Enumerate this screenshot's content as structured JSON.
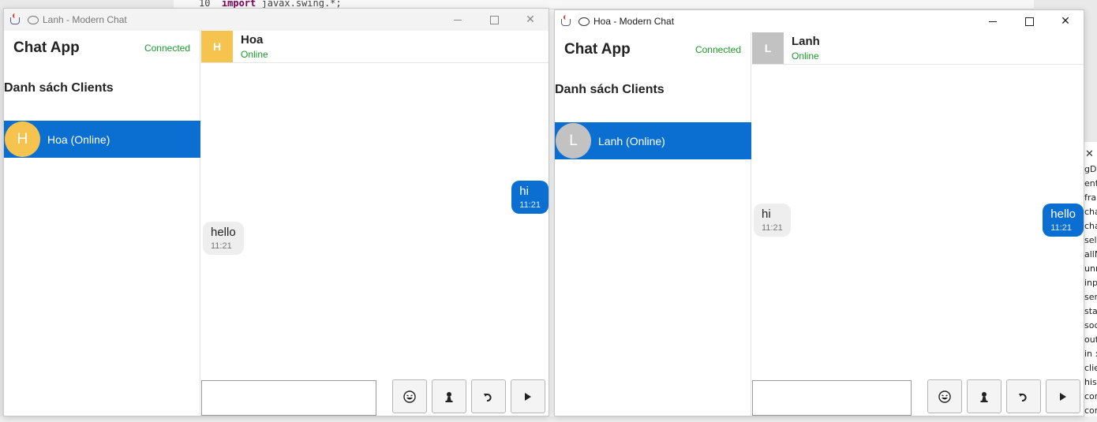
{
  "ide": {
    "line_no": "10",
    "keyword": "import",
    "code": " javax.swing.*;",
    "right_fragments": [
      "gDı",
      "ent",
      "frar",
      "cha",
      "cha",
      "sele",
      "allN",
      "unr",
      "inp",
      "ser",
      "stat",
      "soc",
      "out",
      "in :",
      "clie",
      "hist",
      "cor",
      "cor"
    ]
  },
  "windows": [
    {
      "title": "Lanh - Modern Chat",
      "app_title": "Chat App",
      "connection_status": "Connected",
      "clients_heading": "Danh sách Clients",
      "client": {
        "initial": "H",
        "label": "Hoa (Online)",
        "avatar_color": "#f7c34f"
      },
      "header": {
        "initial": "H",
        "name": "Hoa",
        "status": "Online",
        "avatar_color": "#f7c34f"
      },
      "messages": [
        {
          "text": "hi",
          "time": "11:21",
          "side": "sent"
        },
        {
          "text": "hello",
          "time": "11:21",
          "side": "received"
        }
      ],
      "input_value": ""
    },
    {
      "title": "Hoa - Modern Chat",
      "app_title": "Chat App",
      "connection_status": "Connected",
      "clients_heading": "Danh sách Clients",
      "client": {
        "initial": "L",
        "label": "Lanh (Online)",
        "avatar_color": "#c2c2c2"
      },
      "header": {
        "initial": "L",
        "name": "Lanh",
        "status": "Online",
        "avatar_color": "#c2c2c2"
      },
      "messages": [
        {
          "text": "hi",
          "time": "11:21",
          "side": "received"
        },
        {
          "text": "hello",
          "time": "11:21",
          "side": "sent"
        }
      ],
      "input_value": ""
    }
  ],
  "window_controls": {
    "close": "✕"
  },
  "buttons": [
    "emoji-icon",
    "user-icon",
    "rotate-icon",
    "send-icon"
  ],
  "colors": {
    "accent": "#0a6fd1",
    "online": "#1a9a2a",
    "received_bubble": "#eeeeee"
  }
}
